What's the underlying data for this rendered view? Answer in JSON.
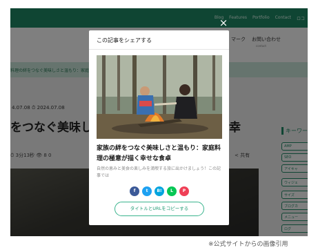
{
  "background": {
    "nav_links": [
      "Blog",
      "Features",
      "Portfolio",
      "Contact",
      "ロコ"
    ],
    "menu": {
      "item_1": "マーク",
      "item_2": "お問い合わせ",
      "item_2_sub": "contact"
    },
    "breadcrumb": "料理の絆をつなぐ美味しさと温もり：家庭",
    "dates": "4.07.08  ⏱ 2024.07.08",
    "title_visible": "をつなぐ美味しさ",
    "title_tail": "く幸",
    "meta": "⏱ 3分13秒  👁 8  0",
    "share_label": "共有",
    "sidebar_title": "キーワー",
    "sidebar_tags": [
      "AMP",
      "API",
      "SEO",
      "アイキャ",
      "ウィジェ",
      "サイズ",
      "ブログカ",
      "メニュー",
      "ログ"
    ]
  },
  "close_label": "×",
  "modal": {
    "header": "この記事をシェアする",
    "title": "家族の絆をつなぐ美味しさと温もり：家庭料理の極意が描く幸せな食卓",
    "excerpt": "自然の恵みと美食の楽しみを満喫する旅に出かけましょう！この記事では",
    "share_buttons": [
      {
        "name": "facebook",
        "glyph": "f",
        "color": "#3b5998"
      },
      {
        "name": "twitter",
        "glyph": "t",
        "color": "#1da1f2"
      },
      {
        "name": "hatena",
        "glyph": "B!",
        "color": "#00a4de"
      },
      {
        "name": "line",
        "glyph": "L",
        "color": "#06c755"
      },
      {
        "name": "pocket",
        "glyph": "P",
        "color": "#ef3f56"
      }
    ],
    "copy_button": "タイトルとURLをコピーする"
  },
  "credit": "※公式サイトからの画像引用"
}
